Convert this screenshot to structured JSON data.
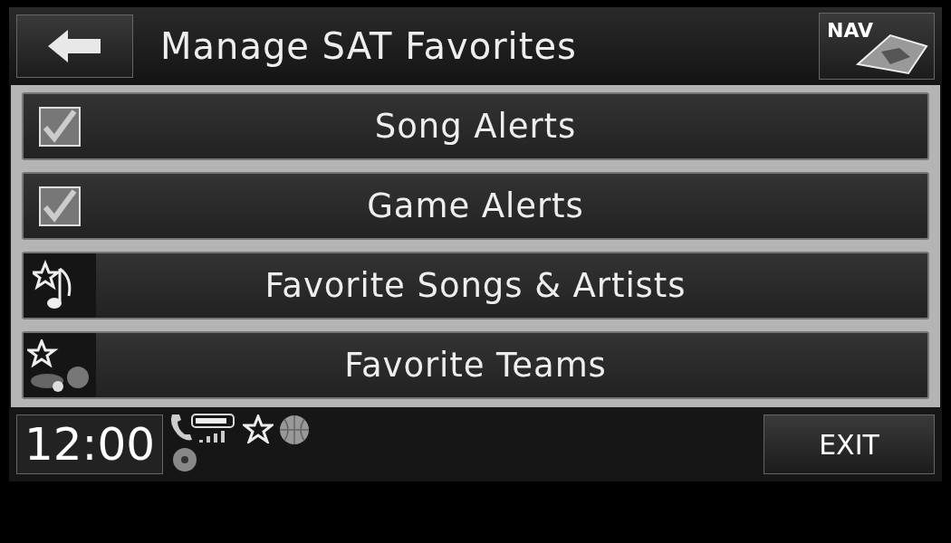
{
  "header": {
    "title": "Manage SAT Favorites",
    "nav_button": "NAV"
  },
  "items": [
    {
      "kind": "checkbox",
      "label": "Song Alerts",
      "checked": true
    },
    {
      "kind": "checkbox",
      "label": "Game Alerts",
      "checked": true
    },
    {
      "kind": "music",
      "label": "Favorite Songs & Artists"
    },
    {
      "kind": "sports",
      "label": "Favorite Teams"
    }
  ],
  "footer": {
    "clock": "12:00",
    "exit_button": "EXIT"
  }
}
